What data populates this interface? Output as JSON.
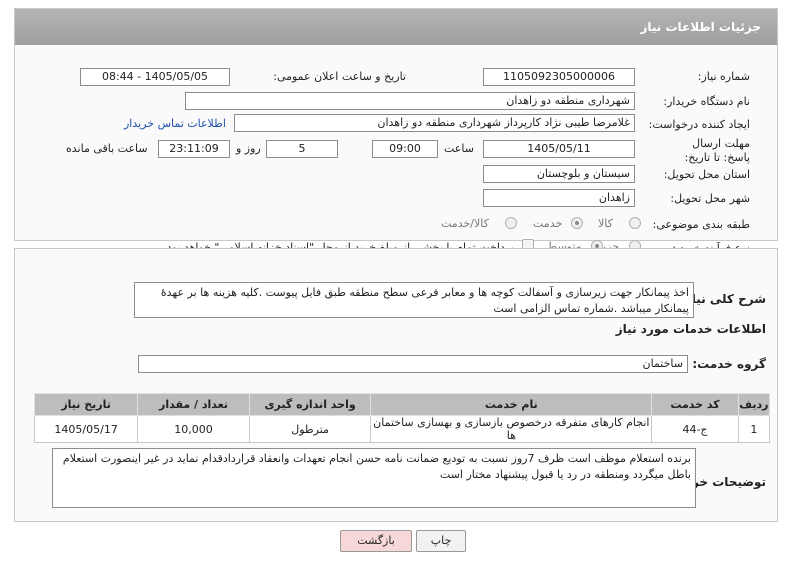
{
  "header": {
    "title": "جزئیات اطلاعات نیاز"
  },
  "fields": {
    "need_number_label": "شماره نیاز:",
    "need_number": "1105092305000006",
    "announce_label": "تاریخ و ساعت اعلان عمومی:",
    "announce_value": "1405/05/05 - 08:44",
    "buyer_org_label": "نام دستگاه خریدار:",
    "buyer_org": "شهرداری منطقه دو زاهدان",
    "creator_label": "ایجاد کننده درخواست:",
    "creator": "غلامرضا طیبی نژاد کارپرداز  شهرداری منطقه دو زاهدان",
    "contact_link": "اطلاعات تماس خریدار",
    "deadline_label": "مهلت ارسال پاسخ: تا تاریخ:",
    "deadline_date": "1405/05/11",
    "time_label": "ساعت",
    "deadline_time": "09:00",
    "days_value": "5",
    "days_label": "روز و",
    "remaining_time": "23:11:09",
    "remaining_label": "ساعت باقی مانده",
    "province_label": "استان محل تحویل:",
    "province": "سیستان و بلوچستان",
    "city_label": "شهر محل تحویل:",
    "city": "زاهدان",
    "category_label": "طبقه بندی موضوعی:",
    "category_options": [
      "کالا",
      "خدمت",
      "کالا/خدمت"
    ],
    "category_selected": "خدمت",
    "process_label": "نوع فرآیند خرید :",
    "process_options": [
      "جزیی",
      "متوسط"
    ],
    "process_selected": "متوسط",
    "payment_note": "پرداخت تمام یا بخشی از مبلغ خرید،از محل \"اسناد خزانه اسلامی\" خواهد بود."
  },
  "description": {
    "label": "شرح کلی نیاز:",
    "text": "اخذ پیمانکار جهت زیرسازی و آسفالت کوچه ها و معابر فرعی سطح منطقه طبق فایل پیوست .کلیه هزینه ها بر عهدهٔ پیمانکار میباشد .شماره تماس الزامی است"
  },
  "services": {
    "section_title": "اطلاعات خدمات مورد نیاز",
    "group_label": "گروه خدمت:",
    "group_value": "ساختمان",
    "columns": [
      "ردیف",
      "کد خدمت",
      "نام خدمت",
      "واحد اندازه گیری",
      "تعداد / مقدار",
      "تاریخ نیاز"
    ],
    "rows": [
      [
        "1",
        "ج-44",
        "انجام کارهای متفرقه درخصوص بازسازی و بهسازی ساختمان ها",
        "مترطول",
        "10,000",
        "1405/05/17"
      ]
    ]
  },
  "buyer_notes": {
    "label": "توضیحات خریدار:",
    "text": "برنده استعلام موظف است ظرف 7روز نسبت به تودیع ضمانت نامه حسن انجام تعهدات وانعقاد قراردادقدام نماید در غیر اینصورت استعلام باطل میگردد ومنطقه در رد یا قبول پیشنهاد مختار است"
  },
  "buttons": {
    "print": "چاپ",
    "back": "بازگشت"
  },
  "colors": {
    "header": "#a8a8a8",
    "link": "#1f4fb0",
    "back_button": "#f6d8d8"
  }
}
